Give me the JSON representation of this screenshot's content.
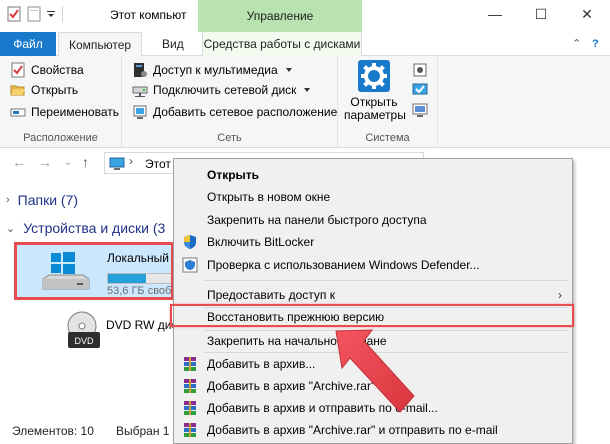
{
  "window": {
    "title": "Этот компьют",
    "contextual_tab_group": "Управление",
    "minimize_glyph": "—",
    "maximize_glyph": "☐",
    "close_glyph": "✕"
  },
  "ribbon_tabs": [
    {
      "label": "Файл"
    },
    {
      "label": "Компьютер"
    },
    {
      "label": "Вид"
    },
    {
      "label": "Средства работы с дисками"
    }
  ],
  "ribbon_controls": {
    "collapse": "⌃",
    "help": "?"
  },
  "ribbon": {
    "location": {
      "label": "Расположение",
      "items": [
        "Свойства",
        "Открыть",
        "Переименовать"
      ]
    },
    "network": {
      "label": "Сеть",
      "items": [
        "Доступ к мультимедиа",
        "Подключить сетевой диск",
        "Добавить сетевое расположение"
      ]
    },
    "system": {
      "label": "Система",
      "open_params_line1": "Открыть",
      "open_params_line2": "параметры"
    }
  },
  "address": {
    "path_text": "Этот"
  },
  "content": {
    "folders_group": "Папки (7)",
    "devices_group": "Устройства и диски (3",
    "local_drive_name": "Локальный",
    "local_drive_free": "53,6 ГБ своб",
    "local_drive_used_fraction": 0.6,
    "dvd_name": "DVD RW дис"
  },
  "status": {
    "items": "Элементов: 10",
    "selected": "Выбран 1 э"
  },
  "context_menu": {
    "items": [
      {
        "label": "Открыть",
        "bold": true,
        "icon": "none"
      },
      {
        "label": "Открыть в новом окне",
        "icon": "none"
      },
      {
        "label": "Закрепить на панели быстрого доступа",
        "icon": "none"
      },
      {
        "label": "Включить BitLocker",
        "icon": "shield-icon"
      },
      {
        "label": "Проверка с использованием Windows Defender...",
        "icon": "defender-icon"
      },
      {
        "label": "Предоставить доступ к",
        "icon": "none",
        "submenu": true
      },
      {
        "label": "Восстановить прежнюю версию",
        "icon": "none",
        "highlighted": true
      },
      {
        "label": "Закрепить на начальном экране",
        "icon": "none"
      },
      {
        "label": "Добавить в архив...",
        "icon": "winrar-icon"
      },
      {
        "label": "Добавить в архив \"Archive.rar\"",
        "icon": "winrar-icon"
      },
      {
        "label": "Добавить в архив и отправить по e-mail...",
        "icon": "winrar-icon"
      },
      {
        "label": "Добавить в архив \"Archive.rar\" и отправить по e-mail",
        "icon": "winrar-icon"
      }
    ],
    "submenu_glyph": "›"
  },
  "colors": {
    "file_tab": "#1979ca",
    "manage_tab": "#b8e3b0",
    "highlight_border": "#e74c4f",
    "arrow": "#ec4c56",
    "selection": "#cce8ff",
    "group_heading": "#1e3287"
  }
}
